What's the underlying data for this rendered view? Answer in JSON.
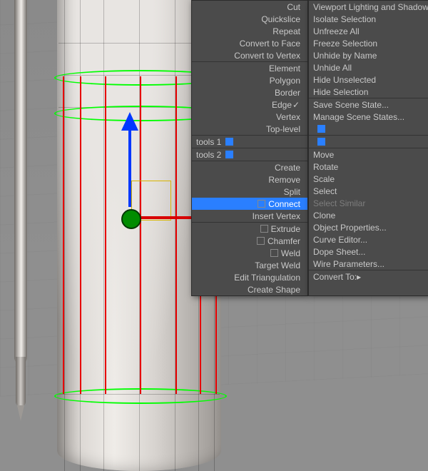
{
  "leftMenu": {
    "top": [
      "Cut",
      "Quickslice",
      "Repeat",
      "Convert to Face",
      "Convert to Vertex"
    ],
    "sub": [
      {
        "label": "Element",
        "check": false
      },
      {
        "label": "Polygon",
        "check": false
      },
      {
        "label": "Border",
        "check": false
      },
      {
        "label": "Edge",
        "check": true
      },
      {
        "label": "Vertex",
        "check": false
      },
      {
        "label": "Top-level",
        "check": false
      }
    ],
    "tools": [
      "tools 1",
      "tools 2"
    ],
    "edit": [
      "Create",
      "Remove",
      "Split",
      "Connect",
      "Insert Vertex"
    ],
    "edit2": [
      "Extrude",
      "Chamfer",
      "Weld",
      "Target Weld",
      "Edit Triangulation",
      "Create Shape"
    ]
  },
  "rightMenu": {
    "top": [
      "Viewport Lighting and Shadows",
      "Isolate Selection",
      "Unfreeze All",
      "Freeze Selection",
      "Unhide by Name",
      "Unhide All",
      "Hide Unselected",
      "Hide Selection"
    ],
    "state": [
      "Save Scene State...",
      "Manage Scene States..."
    ],
    "xform": [
      "Move",
      "Rotate",
      "Scale",
      "Select",
      "Select Similar",
      "Clone",
      "Object Properties...",
      "Curve Editor...",
      "Dope Sheet...",
      "Wire Parameters..."
    ],
    "convert": [
      "Convert To:"
    ]
  },
  "highlight": "Connect",
  "swatches": [
    "#2a7fff",
    "#2a7fff"
  ]
}
